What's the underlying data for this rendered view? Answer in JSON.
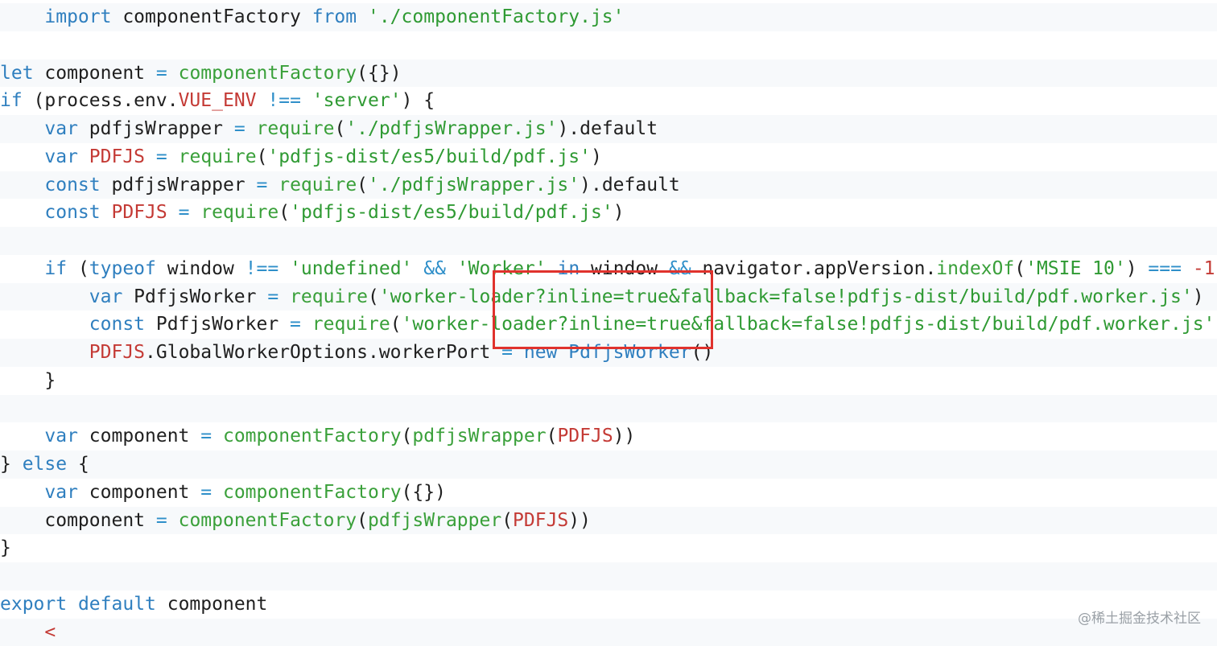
{
  "colors": {
    "keyword": "#2f7fbf",
    "string": "#2f9a33",
    "function": "#3aa03a",
    "operator": "#2f8fc9",
    "constant": "#c43a35",
    "plain": "#1f1f1f",
    "highlight_box": "#e0322d"
  },
  "code": {
    "lines": [
      [
        {
          "t": "    ",
          "c": "plain"
        },
        {
          "t": "import",
          "c": "kw"
        },
        {
          "t": " componentFactory ",
          "c": "plain"
        },
        {
          "t": "from",
          "c": "kw"
        },
        {
          "t": " ",
          "c": "plain"
        },
        {
          "t": "'./componentFactory.js'",
          "c": "str"
        }
      ],
      [],
      [
        {
          "t": "let",
          "c": "kw"
        },
        {
          "t": " component ",
          "c": "plain"
        },
        {
          "t": "=",
          "c": "op"
        },
        {
          "t": " ",
          "c": "plain"
        },
        {
          "t": "componentFactory",
          "c": "fn"
        },
        {
          "t": "({})",
          "c": "plain"
        }
      ],
      [
        {
          "t": "if",
          "c": "kw"
        },
        {
          "t": " (process.env.",
          "c": "plain"
        },
        {
          "t": "VUE_ENV",
          "c": "const"
        },
        {
          "t": " ",
          "c": "plain"
        },
        {
          "t": "!==",
          "c": "op"
        },
        {
          "t": " ",
          "c": "plain"
        },
        {
          "t": "'server'",
          "c": "str"
        },
        {
          "t": ") {",
          "c": "plain"
        }
      ],
      [
        {
          "t": "    ",
          "c": "plain"
        },
        {
          "t": "var",
          "c": "kw"
        },
        {
          "t": " pdfjsWrapper ",
          "c": "plain"
        },
        {
          "t": "=",
          "c": "op"
        },
        {
          "t": " ",
          "c": "plain"
        },
        {
          "t": "require",
          "c": "fn"
        },
        {
          "t": "(",
          "c": "plain"
        },
        {
          "t": "'./pdfjsWrapper.js'",
          "c": "str"
        },
        {
          "t": ").default",
          "c": "plain"
        }
      ],
      [
        {
          "t": "    ",
          "c": "plain"
        },
        {
          "t": "var",
          "c": "kw"
        },
        {
          "t": " ",
          "c": "plain"
        },
        {
          "t": "PDFJS",
          "c": "const"
        },
        {
          "t": " ",
          "c": "plain"
        },
        {
          "t": "=",
          "c": "op"
        },
        {
          "t": " ",
          "c": "plain"
        },
        {
          "t": "require",
          "c": "fn"
        },
        {
          "t": "(",
          "c": "plain"
        },
        {
          "t": "'pdfjs-dist/es5/build/pdf.js'",
          "c": "str"
        },
        {
          "t": ")",
          "c": "plain"
        }
      ],
      [
        {
          "t": "    ",
          "c": "plain"
        },
        {
          "t": "const",
          "c": "kw"
        },
        {
          "t": " pdfjsWrapper ",
          "c": "plain"
        },
        {
          "t": "=",
          "c": "op"
        },
        {
          "t": " ",
          "c": "plain"
        },
        {
          "t": "require",
          "c": "fn"
        },
        {
          "t": "(",
          "c": "plain"
        },
        {
          "t": "'./pdfjsWrapper.js'",
          "c": "str"
        },
        {
          "t": ").default",
          "c": "plain"
        }
      ],
      [
        {
          "t": "    ",
          "c": "plain"
        },
        {
          "t": "const",
          "c": "kw"
        },
        {
          "t": " ",
          "c": "plain"
        },
        {
          "t": "PDFJS",
          "c": "const"
        },
        {
          "t": " ",
          "c": "plain"
        },
        {
          "t": "=",
          "c": "op"
        },
        {
          "t": " ",
          "c": "plain"
        },
        {
          "t": "require",
          "c": "fn"
        },
        {
          "t": "(",
          "c": "plain"
        },
        {
          "t": "'pdfjs-dist/es5/build/pdf.js'",
          "c": "str"
        },
        {
          "t": ")",
          "c": "plain"
        }
      ],
      [],
      [
        {
          "t": "    ",
          "c": "plain"
        },
        {
          "t": "if",
          "c": "kw"
        },
        {
          "t": " (",
          "c": "plain"
        },
        {
          "t": "typeof",
          "c": "kw"
        },
        {
          "t": " window ",
          "c": "plain"
        },
        {
          "t": "!==",
          "c": "op"
        },
        {
          "t": " ",
          "c": "plain"
        },
        {
          "t": "'undefined'",
          "c": "str"
        },
        {
          "t": " ",
          "c": "plain"
        },
        {
          "t": "&&",
          "c": "op"
        },
        {
          "t": " ",
          "c": "plain"
        },
        {
          "t": "'Worker'",
          "c": "str"
        },
        {
          "t": " ",
          "c": "plain"
        },
        {
          "t": "in",
          "c": "kw"
        },
        {
          "t": " window ",
          "c": "plain"
        },
        {
          "t": "&&",
          "c": "op"
        },
        {
          "t": " navigator.appVersion.",
          "c": "plain"
        },
        {
          "t": "indexOf",
          "c": "fn"
        },
        {
          "t": "(",
          "c": "plain"
        },
        {
          "t": "'MSIE 10'",
          "c": "str"
        },
        {
          "t": ") ",
          "c": "plain"
        },
        {
          "t": "===",
          "c": "op"
        },
        {
          "t": " ",
          "c": "plain"
        },
        {
          "t": "-1",
          "c": "const"
        }
      ],
      [
        {
          "t": "        ",
          "c": "plain"
        },
        {
          "t": "var",
          "c": "kw"
        },
        {
          "t": " PdfjsWorker ",
          "c": "plain"
        },
        {
          "t": "=",
          "c": "op"
        },
        {
          "t": " ",
          "c": "plain"
        },
        {
          "t": "require",
          "c": "fn"
        },
        {
          "t": "(",
          "c": "plain"
        },
        {
          "t": "'worker-loader?inline=true&fallback=false!pdfjs-dist/build/pdf.worker.js'",
          "c": "str"
        },
        {
          "t": ")",
          "c": "plain"
        }
      ],
      [
        {
          "t": "        ",
          "c": "plain"
        },
        {
          "t": "const",
          "c": "kw"
        },
        {
          "t": " PdfjsWorker ",
          "c": "plain"
        },
        {
          "t": "=",
          "c": "op"
        },
        {
          "t": " ",
          "c": "plain"
        },
        {
          "t": "require",
          "c": "fn"
        },
        {
          "t": "(",
          "c": "plain"
        },
        {
          "t": "'worker-loader?inline=true&fallback=false!pdfjs-dist/build/pdf.worker.js'",
          "c": "str"
        }
      ],
      [
        {
          "t": "        ",
          "c": "plain"
        },
        {
          "t": "PDFJS",
          "c": "const"
        },
        {
          "t": ".GlobalWorkerOptions.workerPort ",
          "c": "plain"
        },
        {
          "t": "=",
          "c": "op"
        },
        {
          "t": " ",
          "c": "plain"
        },
        {
          "t": "new",
          "c": "kw"
        },
        {
          "t": " ",
          "c": "plain"
        },
        {
          "t": "PdfjsWorker",
          "c": "kw"
        },
        {
          "t": "()",
          "c": "plain"
        }
      ],
      [
        {
          "t": "    }",
          "c": "plain"
        }
      ],
      [],
      [
        {
          "t": "    ",
          "c": "plain"
        },
        {
          "t": "var",
          "c": "kw"
        },
        {
          "t": " component ",
          "c": "plain"
        },
        {
          "t": "=",
          "c": "op"
        },
        {
          "t": " ",
          "c": "plain"
        },
        {
          "t": "componentFactory",
          "c": "fn"
        },
        {
          "t": "(",
          "c": "plain"
        },
        {
          "t": "pdfjsWrapper",
          "c": "fn"
        },
        {
          "t": "(",
          "c": "plain"
        },
        {
          "t": "PDFJS",
          "c": "const"
        },
        {
          "t": "))",
          "c": "plain"
        }
      ],
      [
        {
          "t": "} ",
          "c": "plain"
        },
        {
          "t": "else",
          "c": "kw"
        },
        {
          "t": " {",
          "c": "plain"
        }
      ],
      [
        {
          "t": "    ",
          "c": "plain"
        },
        {
          "t": "var",
          "c": "kw"
        },
        {
          "t": " component ",
          "c": "plain"
        },
        {
          "t": "=",
          "c": "op"
        },
        {
          "t": " ",
          "c": "plain"
        },
        {
          "t": "componentFactory",
          "c": "fn"
        },
        {
          "t": "({})",
          "c": "plain"
        }
      ],
      [
        {
          "t": "    component ",
          "c": "plain"
        },
        {
          "t": "=",
          "c": "op"
        },
        {
          "t": " ",
          "c": "plain"
        },
        {
          "t": "componentFactory",
          "c": "fn"
        },
        {
          "t": "(",
          "c": "plain"
        },
        {
          "t": "pdfjsWrapper",
          "c": "fn"
        },
        {
          "t": "(",
          "c": "plain"
        },
        {
          "t": "PDFJS",
          "c": "const"
        },
        {
          "t": "))",
          "c": "plain"
        }
      ],
      [
        {
          "t": "}",
          "c": "plain"
        }
      ],
      [],
      [
        {
          "t": "export",
          "c": "kw"
        },
        {
          "t": " ",
          "c": "plain"
        },
        {
          "t": "default",
          "c": "kw"
        },
        {
          "t": " component",
          "c": "plain"
        }
      ],
      [
        {
          "t": "    ",
          "c": "plain"
        },
        {
          "t": "<",
          "c": "const"
        }
      ]
    ]
  },
  "watermark": "@稀土掘金技术社区"
}
